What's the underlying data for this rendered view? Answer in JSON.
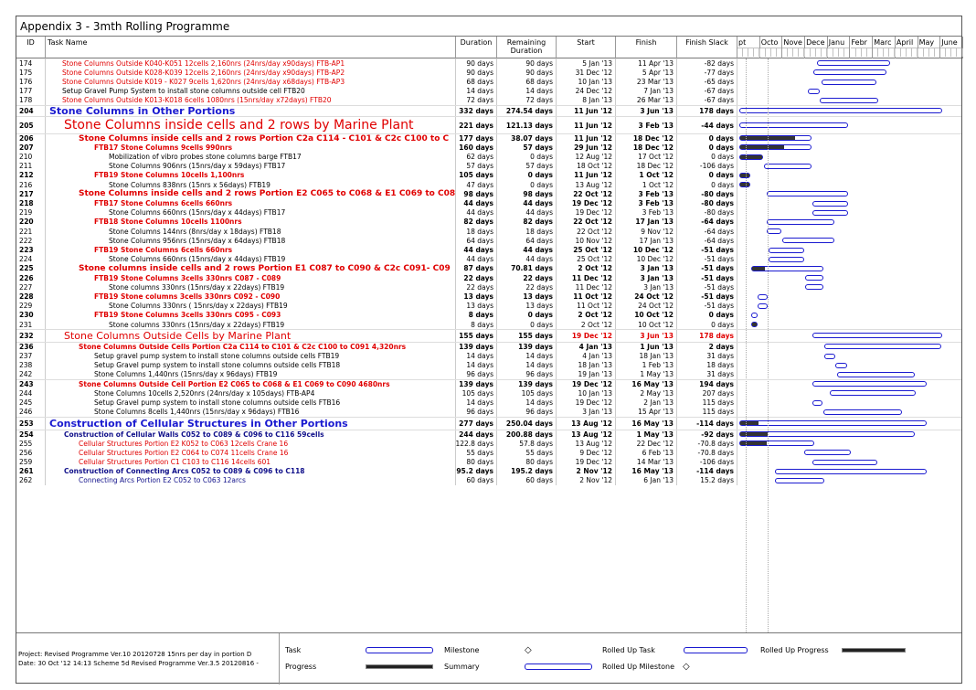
{
  "title": "Appendix 3 - 3mth Rolling Programme",
  "columns": {
    "id": "ID",
    "name": "Task Name",
    "duration": "Duration",
    "remaining": "Remaining Duration",
    "start": "Start",
    "finish": "Finish",
    "slack": "Finish Slack"
  },
  "months": [
    "pt",
    "Octo",
    "Nove",
    "Dece",
    "Janu",
    "Febr",
    "Marc",
    "April",
    "May",
    "June"
  ],
  "rows": [
    {
      "id": "174",
      "name": "Stone Columns Outside K040-K051 12cells 2,160nrs (24nrs/day x90days) FTB-AP1",
      "dur": "90 days",
      "rem": "90 days",
      "start": "5 Jan '13",
      "finish": "11 Apr '13",
      "slack": "-82 days",
      "style": "red",
      "indent": 50,
      "bar": {
        "start": 0.385,
        "end": 0.745
      }
    },
    {
      "id": "175",
      "name": "Stone Columns Outside K028-K039 12cells 2,160nrs (24nrs/day x90days) FTB-AP2",
      "dur": "90 days",
      "rem": "90 days",
      "start": "31 Dec '12",
      "finish": "5 Apr '13",
      "slack": "-77 days",
      "style": "red",
      "indent": 50,
      "bar": {
        "start": 0.365,
        "end": 0.725
      }
    },
    {
      "id": "176",
      "name": "Stone Columns Outside K019 - K027 9cells 1,620nrs (24nrs/day x68days) FTB-AP3",
      "dur": "68 days",
      "rem": "68 days",
      "start": "10 Jan '13",
      "finish": "23 Mar '13",
      "slack": "-65 days",
      "style": "red",
      "indent": 50,
      "bar": {
        "start": 0.405,
        "end": 0.675
      }
    },
    {
      "id": "177",
      "name": "Setup Gravel Pump System to install stone columns outside cell FTB20",
      "dur": "14 days",
      "rem": "14 days",
      "start": "24 Dec '12",
      "finish": "7 Jan '13",
      "slack": "-67 days",
      "style": "",
      "indent": 50,
      "bar": {
        "start": 0.34,
        "end": 0.395
      }
    },
    {
      "id": "178",
      "name": "Stone Columns Outside K013-K018 6cells 1080nrs (15nrs/day x72days) FTB20",
      "dur": "72 days",
      "rem": "72 days",
      "start": "8 Jan '13",
      "finish": "26 Mar '13",
      "slack": "-67 days",
      "style": "red",
      "indent": 50,
      "bar": {
        "start": 0.395,
        "end": 0.685
      }
    },
    {
      "id": "204",
      "name": "Stone Columns in Other Portions",
      "dur": "332 days",
      "rem": "274.54 days",
      "start": "11 Jun '12",
      "finish": "3 Jun '13",
      "slack": "178 days",
      "style": "blue bold",
      "size": 11,
      "indent": 36,
      "bar": {
        "start": 0.0,
        "end": 1.0
      }
    },
    {
      "id": "205",
      "name": "Stone Columns inside cells and 2 rows by Marine Plant",
      "dur": "221 days",
      "rem": "121.13 days",
      "start": "11 Jun '12",
      "finish": "3 Feb '13",
      "slack": "-44 days",
      "style": "red",
      "size": 14,
      "indent": 52,
      "bar": {
        "start": 0.0,
        "end": 0.535
      }
    },
    {
      "id": "206",
      "name": "Stone Columns inside cells and 2 rows  Portion C2a C114 - C101 & C2c C100 to C",
      "dur": "177 days",
      "rem": "38.07 days",
      "start": "11 Jun '12",
      "finish": "18 Dec '12",
      "slack": "0 days",
      "style": "red bold",
      "size": 9,
      "indent": 68,
      "bar": {
        "start": 0.0,
        "end": 0.355,
        "prog": 0.78
      }
    },
    {
      "id": "207",
      "name": "FTB17 Stone Columns 9cells 990nrs",
      "dur": "160 days",
      "rem": "57 days",
      "start": "29 Jun '12",
      "finish": "18 Dec '12",
      "slack": "0 days",
      "style": "red bold",
      "indent": 85,
      "bar": {
        "start": 0.0,
        "end": 0.355,
        "prog": 0.62
      }
    },
    {
      "id": "210",
      "name": "Mobilization of vibro probes stone columns barge FTB17",
      "dur": "62 days",
      "rem": "0 days",
      "start": "12 Aug '12",
      "finish": "17 Oct '12",
      "slack": "0 days",
      "style": "",
      "indent": 101,
      "bar": {
        "start": 0.0,
        "end": 0.115,
        "prog": 1.0
      }
    },
    {
      "id": "211",
      "name": "Stone Columns 906nrs (15nrs/day x 59days) FTB17",
      "dur": "57 days",
      "rem": "57 days",
      "start": "18 Oct '12",
      "finish": "18 Dec '12",
      "slack": "-106 days",
      "style": "",
      "indent": 101,
      "bar": {
        "start": 0.12,
        "end": 0.355
      }
    },
    {
      "id": "212",
      "name": "FTB19 Stone Columns 10cells 1,100nrs",
      "dur": "105 days",
      "rem": "0 days",
      "start": "11 Jun '12",
      "finish": "1 Oct '12",
      "slack": "0 days",
      "style": "red bold",
      "indent": 85,
      "bar": {
        "start": 0.0,
        "end": 0.055,
        "prog": 1.0
      }
    },
    {
      "id": "216",
      "name": "Stone Columns 838nrs (15nrs x 56days) FTB19",
      "dur": "47 days",
      "rem": "0 days",
      "start": "13 Aug '12",
      "finish": "1 Oct '12",
      "slack": "0 days",
      "style": "",
      "indent": 101,
      "bar": {
        "start": 0.0,
        "end": 0.055,
        "prog": 1.0
      }
    },
    {
      "id": "217",
      "name": "Stone Columns inside cells and 2 rows Portion E2 C065 to C068 & E1 C069 to C08",
      "dur": "98 days",
      "rem": "98 days",
      "start": "22 Oct '12",
      "finish": "3 Feb '13",
      "slack": "-80 days",
      "style": "red bold",
      "size": 9,
      "indent": 68,
      "bar": {
        "start": 0.135,
        "end": 0.535
      }
    },
    {
      "id": "218",
      "name": "FTB17 Stone Columns 6cells 660nrs",
      "dur": "44 days",
      "rem": "44 days",
      "start": "19 Dec '12",
      "finish": "3 Feb '13",
      "slack": "-80 days",
      "style": "red bold",
      "indent": 85,
      "bar": {
        "start": 0.36,
        "end": 0.535
      }
    },
    {
      "id": "219",
      "name": "Stone Columns 660nrs (15nrs/day x 44days) FTB17",
      "dur": "44 days",
      "rem": "44 days",
      "start": "19 Dec '12",
      "finish": "3 Feb '13",
      "slack": "-80 days",
      "style": "",
      "indent": 101,
      "bar": {
        "start": 0.36,
        "end": 0.535
      }
    },
    {
      "id": "220",
      "name": "FTB18 Stone Columns 10cells 1100nrs",
      "dur": "82 days",
      "rem": "82 days",
      "start": "22 Oct '12",
      "finish": "17 Jan '13",
      "slack": "-64 days",
      "style": "red bold",
      "indent": 85,
      "bar": {
        "start": 0.135,
        "end": 0.47
      }
    },
    {
      "id": "221",
      "name": "Stone Columns 144nrs (8nrs/day x 18days) FTB18",
      "dur": "18 days",
      "rem": "18 days",
      "start": "22 Oct '12",
      "finish": "9 Nov '12",
      "slack": "-64 days",
      "style": "",
      "indent": 101,
      "bar": {
        "start": 0.135,
        "end": 0.205
      }
    },
    {
      "id": "222",
      "name": "Stone Columns 956nrs (15nrs/day x 64days) FTB18",
      "dur": "64 days",
      "rem": "64 days",
      "start": "10 Nov '12",
      "finish": "17 Jan '13",
      "slack": "-64 days",
      "style": "",
      "indent": 101,
      "bar": {
        "start": 0.21,
        "end": 0.47
      }
    },
    {
      "id": "223",
      "name": "FTB19 Stone Columns 6cells 660nrs",
      "dur": "44 days",
      "rem": "44 days",
      "start": "25 Oct '12",
      "finish": "10 Dec '12",
      "slack": "-51 days",
      "style": "red bold",
      "indent": 85,
      "bar": {
        "start": 0.145,
        "end": 0.32
      }
    },
    {
      "id": "224",
      "name": "Stone Columns 660nrs  (15nrs/day x 44days) FTB19",
      "dur": "44 days",
      "rem": "44 days",
      "start": "25 Oct '12",
      "finish": "10 Dec '12",
      "slack": "-51 days",
      "style": "",
      "indent": 101,
      "bar": {
        "start": 0.145,
        "end": 0.32
      }
    },
    {
      "id": "225",
      "name": "Stone columns inside cells and 2 rows Portion E1 C087 to C090 & C2c C091- C09",
      "dur": "87 days",
      "rem": "70.81 days",
      "start": "2 Oct '12",
      "finish": "3 Jan '13",
      "slack": "-51 days",
      "style": "red bold",
      "size": 9,
      "indent": 68,
      "bar": {
        "start": 0.06,
        "end": 0.415,
        "prog": 0.18
      }
    },
    {
      "id": "226",
      "name": "FTB19 Stone Columns 3cells 330nrs C087 - C089",
      "dur": "22 days",
      "rem": "22 days",
      "start": "11 Dec '12",
      "finish": "3 Jan '13",
      "slack": "-51 days",
      "style": "red bold",
      "indent": 85,
      "bar": {
        "start": 0.325,
        "end": 0.415
      }
    },
    {
      "id": "227",
      "name": "Stone columns 330nrs (15nrs/day x 22days) FTB19",
      "dur": "22 days",
      "rem": "22 days",
      "start": "11 Dec '12",
      "finish": "3 Jan '13",
      "slack": "-51 days",
      "style": "",
      "indent": 101,
      "bar": {
        "start": 0.325,
        "end": 0.415
      }
    },
    {
      "id": "228",
      "name": "FTB19 Stone columns 3cells 330nrs C092 - C090",
      "dur": "13 days",
      "rem": "13 days",
      "start": "11 Oct '12",
      "finish": "24 Oct '12",
      "slack": "-51 days",
      "style": "red bold",
      "indent": 85,
      "bar": {
        "start": 0.09,
        "end": 0.14
      }
    },
    {
      "id": "229",
      "name": "Stone Columns 330nrs ( 15nrs/day x 22days) FTB19",
      "dur": "13 days",
      "rem": "13 days",
      "start": "11 Oct '12",
      "finish": "24 Oct '12",
      "slack": "-51 days",
      "style": "",
      "indent": 101,
      "bar": {
        "start": 0.09,
        "end": 0.14
      }
    },
    {
      "id": "230",
      "name": "FTB19 Stone Columns 3cells 330nrs C095 - C093",
      "dur": "8 days",
      "rem": "0 days",
      "start": "2 Oct '12",
      "finish": "10 Oct '12",
      "slack": "0 days",
      "style": "red bold",
      "indent": 85,
      "bar": {
        "start": 0.06,
        "end": 0.09
      }
    },
    {
      "id": "231",
      "name": "Stone columns 330nrs (15nrs/day x 22days) FTB19",
      "dur": "8 days",
      "rem": "0 days",
      "start": "2 Oct '12",
      "finish": "10 Oct '12",
      "slack": "0 days",
      "style": "",
      "indent": 101,
      "bar": {
        "start": 0.06,
        "end": 0.09,
        "prog": 1.0
      }
    },
    {
      "id": "232",
      "name": "Stone Columns Outside Cells by Marine Plant",
      "dur": "155 days",
      "rem": "155 days",
      "start": "19 Dec '12",
      "finish": "3 Jun '13",
      "slack": "178 days",
      "style": "red",
      "size": 11,
      "indent": 52,
      "bar": {
        "start": 0.36,
        "end": 1.0
      }
    },
    {
      "id": "236",
      "name": "Stone Columns Outside Cells Portion C2a C114 to C101 & C2c C100 to C091 4,320nrs",
      "dur": "139 days",
      "rem": "139 days",
      "start": "4 Jan '13",
      "finish": "1 Jun '13",
      "slack": "2 days",
      "style": "red bold",
      "indent": 68,
      "bar": {
        "start": 0.42,
        "end": 0.995
      }
    },
    {
      "id": "237",
      "name": "Setup gravel pump system to install stone columns outside cells FTB19",
      "dur": "14 days",
      "rem": "14 days",
      "start": "4 Jan '13",
      "finish": "18 Jan '13",
      "slack": "31 days",
      "style": "",
      "indent": 85,
      "bar": {
        "start": 0.42,
        "end": 0.475
      }
    },
    {
      "id": "238",
      "name": "Setup Gravel pump system to install stone columns outside cells FTB18",
      "dur": "14 days",
      "rem": "14 days",
      "start": "18 Jan '13",
      "finish": "1 Feb '13",
      "slack": "18 days",
      "style": "",
      "indent": 85,
      "bar": {
        "start": 0.475,
        "end": 0.53
      }
    },
    {
      "id": "242",
      "name": "Stone Columns 1,440nrs (15nrs/day x 96days) FTB19",
      "dur": "96 days",
      "rem": "96 days",
      "start": "19 Jan '13",
      "finish": "1 May '13",
      "slack": "31 days",
      "style": "",
      "indent": 85,
      "bar": {
        "start": 0.48,
        "end": 0.865
      }
    },
    {
      "id": "243",
      "name": "Stone Columns Outside Cell Portion E2 C065 to C068 & E1 C069 to C090 4680nrs",
      "dur": "139 days",
      "rem": "139 days",
      "start": "19 Dec '12",
      "finish": "16 May '13",
      "slack": "194 days",
      "style": "red bold",
      "indent": 68,
      "bar": {
        "start": 0.36,
        "end": 0.925
      }
    },
    {
      "id": "244",
      "name": "Stone Columns 10cells 2,520nrs (24nrs/day x 105days) FTB-AP4",
      "dur": "105 days",
      "rem": "105 days",
      "start": "10 Jan '13",
      "finish": "2 May '13",
      "slack": "207 days",
      "style": "",
      "indent": 85,
      "bar": {
        "start": 0.445,
        "end": 0.87
      }
    },
    {
      "id": "245",
      "name": "Setup Gravel pump system to install stone columns outside cells FTB16",
      "dur": "14 days",
      "rem": "14 days",
      "start": "19 Dec '12",
      "finish": "2 Jan '13",
      "slack": "115 days",
      "style": "",
      "indent": 85,
      "bar": {
        "start": 0.36,
        "end": 0.41
      }
    },
    {
      "id": "246",
      "name": "Stone Columns 8cells 1,440nrs (15nrs/day x 96days) FTB16",
      "dur": "96 days",
      "rem": "96 days",
      "start": "3 Jan '13",
      "finish": "15 Apr '13",
      "slack": "115 days",
      "style": "",
      "indent": 85,
      "bar": {
        "start": 0.415,
        "end": 0.8
      }
    },
    {
      "id": "253",
      "name": "Construction of Cellular Structures in Other Portions",
      "dur": "277 days",
      "rem": "250.04 days",
      "start": "13 Aug '12",
      "finish": "16 May '13",
      "slack": "-114 days",
      "style": "blue bold",
      "size": 11,
      "indent": 36,
      "bar": {
        "start": 0.0,
        "end": 0.925,
        "prog": 0.1
      }
    },
    {
      "id": "254",
      "name": "Construction of Cellular Walls C052 to C089 & C096 to C116 59cells",
      "dur": "244 days",
      "rem": "200.88 days",
      "start": "13 Aug '12",
      "finish": "1 May '13",
      "slack": "-92 days",
      "style": "navy bold",
      "indent": 52,
      "bar": {
        "start": 0.0,
        "end": 0.865,
        "prog": 0.16
      }
    },
    {
      "id": "255",
      "name": "Cellular Structures Portion E2 K052 to C063 12cells Crane 16",
      "dur": "122.8 days",
      "rem": "57.8 days",
      "start": "13 Aug '12",
      "finish": "22 Dec '12",
      "slack": "-70.8 days",
      "style": "red",
      "indent": 68,
      "bar": {
        "start": 0.0,
        "end": 0.37,
        "prog": 0.36
      }
    },
    {
      "id": "256",
      "name": "Cellular Structures Portion E2 C064 to C074 11cells Crane 16",
      "dur": "55 days",
      "rem": "55 days",
      "start": "9 Dec '12",
      "finish": "6 Feb '13",
      "slack": "-70.8 days",
      "style": "red",
      "indent": 68,
      "bar": {
        "start": 0.32,
        "end": 0.55
      }
    },
    {
      "id": "259",
      "name": "Cellular Structures Portion C1 C103 to C116 14cells 601",
      "dur": "80 days",
      "rem": "80 days",
      "start": "19 Dec '12",
      "finish": "14 Mar '13",
      "slack": "-106 days",
      "style": "red",
      "indent": 68,
      "bar": {
        "start": 0.36,
        "end": 0.68
      }
    },
    {
      "id": "261",
      "name": "Construction of Connecting Arcs C052 to C089 & C096 to C118",
      "dur": "195.2 days",
      "rem": "195.2 days",
      "start": "2 Nov '12",
      "finish": "16 May '13",
      "slack": "-114 days",
      "style": "navy bold",
      "indent": 52,
      "bar": {
        "start": 0.175,
        "end": 0.925
      }
    },
    {
      "id": "262",
      "name": "Connecting Arcs Portion E2 C052 to C063 12arcs",
      "dur": "60 days",
      "rem": "60 days",
      "start": "2 Nov '12",
      "finish": "6 Jan '13",
      "slack": "15.2 days",
      "style": "navy",
      "indent": 68,
      "bar": {
        "start": 0.175,
        "end": 0.42
      }
    }
  ],
  "footer": {
    "project_line": "Project: Revised Programme Ver.10 20120728 15nrs per day in portion D",
    "date_line": "Date: 30 Oct '12 14:13   Scheme 5d Revised Programme Ver.3.5 20120816 -",
    "legend": {
      "task": "Task",
      "progress": "Progress",
      "milestone": "Milestone",
      "summary": "Summary",
      "rolled_task": "Rolled Up Task",
      "rolled_milestone": "Rolled Up Milestone",
      "rolled_progress": "Rolled Up Progress",
      "diamond": "◇"
    }
  },
  "colors": {
    "red_text": "#e00000",
    "blue_text": "#1a1ad0",
    "bar_border": "#1a1ad0"
  }
}
